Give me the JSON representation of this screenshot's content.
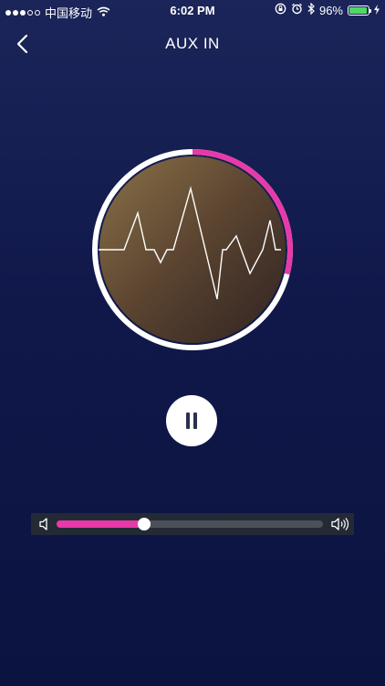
{
  "status_bar": {
    "carrier": "中国移动",
    "time": "6:02 PM",
    "battery_percent": "96%",
    "signal_bars": 3,
    "signal_total": 5,
    "icons": [
      "wifi-icon",
      "screen-rotation-lock-icon",
      "alarm-icon",
      "bluetooth-icon",
      "battery-icon",
      "charging-bolt-icon"
    ]
  },
  "nav": {
    "title": "AUX IN",
    "back_icon": "chevron-left-icon"
  },
  "player": {
    "progress_fraction": 0.29,
    "progress_color": "#e73aa8",
    "ring_color": "#ffffff",
    "state": "playing",
    "control_icon": "pause-icon"
  },
  "volume": {
    "level_fraction": 0.33,
    "fill_color": "#e73aa8",
    "min_icon": "volume-low-icon",
    "max_icon": "volume-high-icon"
  },
  "colors": {
    "background_top": "#1b2559",
    "background_bottom": "#0b1340",
    "battery_green": "#4cd964"
  }
}
